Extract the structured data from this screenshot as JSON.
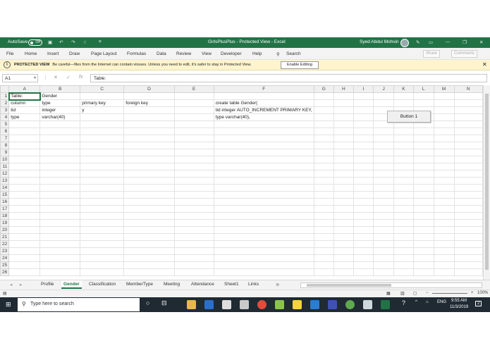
{
  "titlebar": {
    "autosave": "AutoSave",
    "toggle": "Off",
    "title": "GirlsPlusPlus - Protected View - Excel",
    "user": "Syed Abdul Mohsin"
  },
  "ribbon": {
    "tabs": [
      "File",
      "Home",
      "Insert",
      "Draw",
      "Page Layout",
      "Formulas",
      "Data",
      "Review",
      "View",
      "Developer",
      "Help"
    ],
    "search": "Search",
    "share": "Share",
    "comments": "Comments"
  },
  "protected": {
    "label": "PROTECTED VIEW",
    "message": "Be careful—files from the Internet can contain viruses. Unless you need to edit, it's safer to stay in Protected View.",
    "enable": "Enable Editing"
  },
  "formula_bar": {
    "name_box": "A1",
    "formula": "Table:"
  },
  "grid": {
    "columns": [
      "A",
      "B",
      "C",
      "D",
      "E",
      "F",
      "G",
      "H",
      "I",
      "J",
      "K",
      "L",
      "M",
      "N"
    ],
    "rows": [
      [
        "Table:",
        "Gender",
        "",
        "",
        "",
        "",
        "",
        "",
        "",
        "",
        "",
        "",
        "",
        ""
      ],
      [
        "column",
        "type",
        "primary key",
        "foreign key",
        "",
        "create table Gender(",
        "",
        "",
        "",
        "",
        "",
        "",
        "",
        ""
      ],
      [
        "tid",
        "integer",
        "y",
        "",
        "",
        "tid integer AUTO_INCREMENT PRIMARY KEY,",
        "",
        "",
        "",
        "",
        "",
        "",
        "",
        ""
      ],
      [
        "type",
        "varchar(40)",
        "",
        "",
        "",
        "type varchar(40),",
        "",
        "",
        "",
        "",
        "",
        "",
        "",
        ""
      ]
    ],
    "total_rows": 26
  },
  "button1": "Button 1",
  "sheets": {
    "tabs": [
      "Profile",
      "Gender",
      "Classification",
      "MemberType",
      "Meeting",
      "Attendance",
      "Sheet1",
      "Links"
    ],
    "active": "Gender"
  },
  "status": {
    "zoom": "100%"
  },
  "taskbar": {
    "search_placeholder": "Type here to search",
    "lang": "ENG",
    "time": "9:55 AM",
    "date": "11/3/2019",
    "notifications": "2"
  },
  "colors": {
    "excel_green": "#217346",
    "warning_bg": "#fff4ce"
  }
}
